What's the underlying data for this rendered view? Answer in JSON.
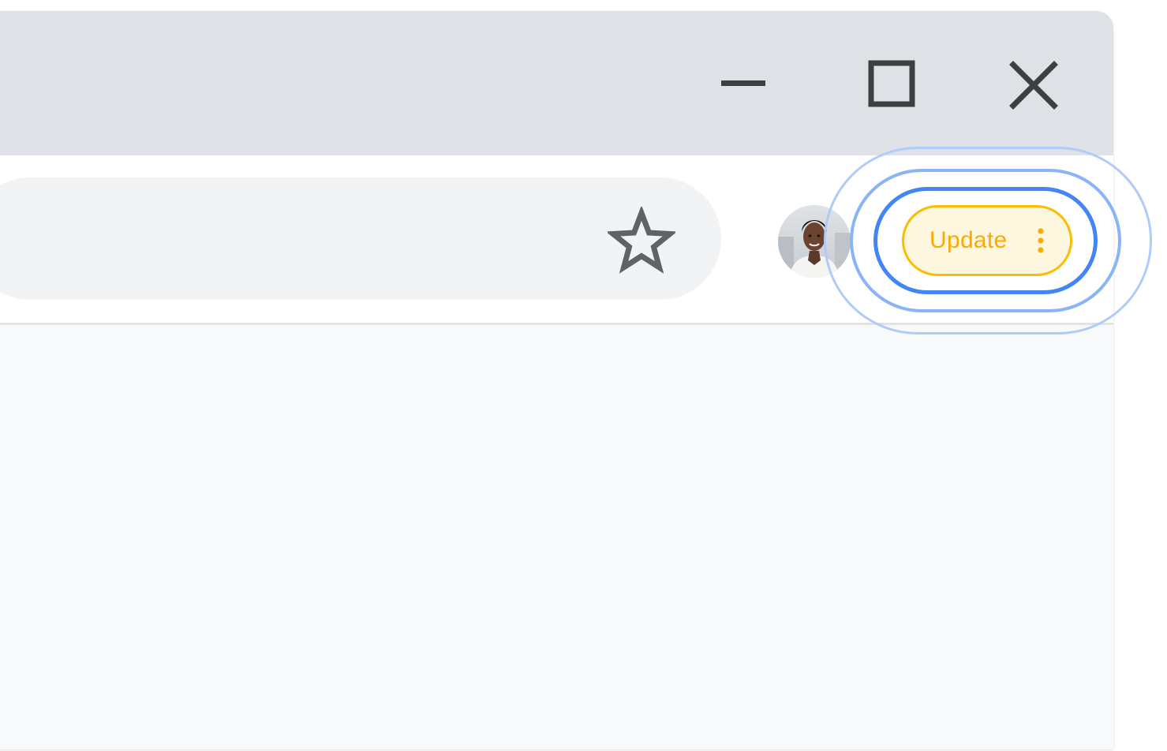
{
  "window_controls": {
    "minimize_icon": "minimize-icon",
    "maximize_icon": "maximize-icon",
    "close_icon": "close-icon",
    "icon_color": "#3c4043"
  },
  "toolbar": {
    "bookmark_icon": "star-outline-icon",
    "profile_avatar": "profile-avatar",
    "update_button": {
      "label": "Update",
      "menu_icon": "three-dot-vertical-icon",
      "color": "#fbbc04",
      "highlight_color": "#4285f4"
    }
  },
  "colors": {
    "titlebar": "#dee1e6",
    "toolbar": "#ffffff",
    "omnibox": "#f1f3f4",
    "content": "#f8f9fa"
  }
}
